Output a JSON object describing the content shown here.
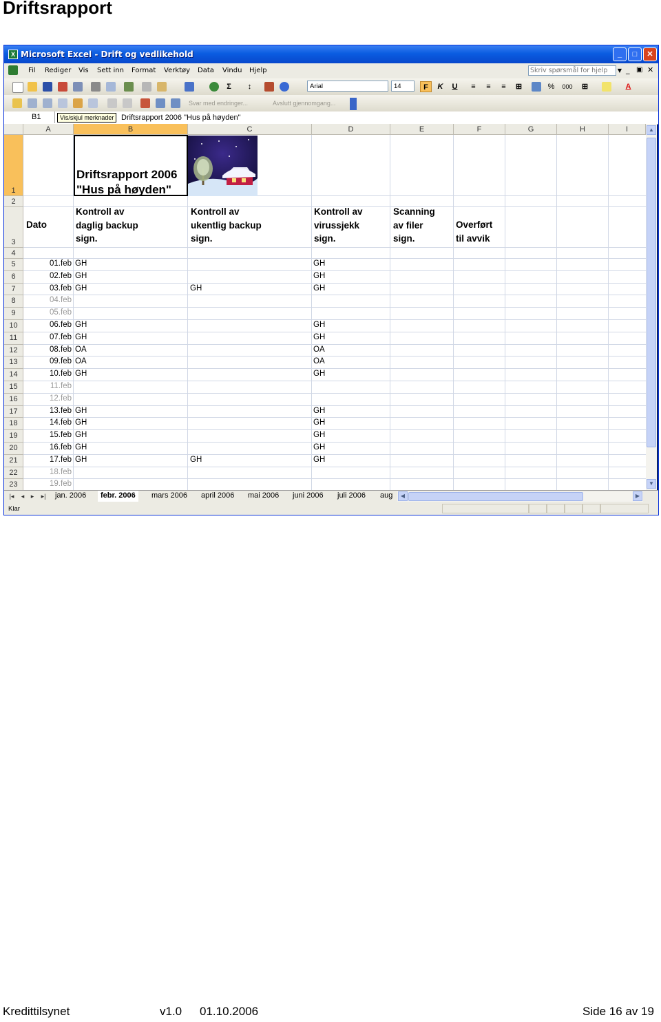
{
  "page": {
    "heading": "Driftsrapport"
  },
  "window": {
    "title": "Microsoft Excel - Drift og vedlikehold",
    "app_icon": "excel-icon"
  },
  "menu": {
    "items": [
      "Fil",
      "Rediger",
      "Vis",
      "Sett inn",
      "Format",
      "Verktøy",
      "Data",
      "Vindu",
      "Hjelp"
    ],
    "help_placeholder": "Skriv spørsmål for hjelp"
  },
  "toolbar": {
    "font": "Arial",
    "size": "14",
    "bold": "F",
    "italic": "K",
    "underline": "U",
    "percent": "%",
    "thousands": "000",
    "review_reply": "Svar med endringer...",
    "review_end": "Avslutt gjennomgang..."
  },
  "formula": {
    "namebox": "B1",
    "tooltip": "Vis/skjul merknader",
    "content": "Driftsrapport 2006 \"Hus på høyden\""
  },
  "columns": [
    "A",
    "B",
    "C",
    "D",
    "E",
    "F",
    "G",
    "H",
    "I"
  ],
  "rows": [
    "1",
    "2",
    "3",
    "4",
    "5",
    "6",
    "7",
    "8",
    "9",
    "10",
    "11",
    "12",
    "13",
    "14",
    "15",
    "16",
    "17",
    "18",
    "19",
    "20",
    "21",
    "22",
    "23"
  ],
  "sheet": {
    "title_line1": "Driftsrapport 2006",
    "title_line2": "\"Hus på høyden\"",
    "hdr_dato": "Dato",
    "hdr_b": [
      "Kontroll av",
      "daglig backup",
      "sign."
    ],
    "hdr_c": [
      "Kontroll av",
      "ukentlig backup",
      "sign."
    ],
    "hdr_d": [
      "Kontroll av",
      "virussjekk",
      "sign."
    ],
    "hdr_e": [
      "Scanning",
      "av filer",
      "sign."
    ],
    "hdr_f": [
      "Overført",
      "til avvik"
    ],
    "data": [
      {
        "date": "01.feb",
        "b": "GH",
        "c": "",
        "d": "GH",
        "weekend": false
      },
      {
        "date": "02.feb",
        "b": "GH",
        "c": "",
        "d": "GH",
        "weekend": false
      },
      {
        "date": "03.feb",
        "b": "GH",
        "c": "GH",
        "d": "GH",
        "weekend": false
      },
      {
        "date": "04.feb",
        "b": "",
        "c": "",
        "d": "",
        "weekend": true
      },
      {
        "date": "05.feb",
        "b": "",
        "c": "",
        "d": "",
        "weekend": true
      },
      {
        "date": "06.feb",
        "b": "GH",
        "c": "",
        "d": "GH",
        "weekend": false
      },
      {
        "date": "07.feb",
        "b": "GH",
        "c": "",
        "d": "GH",
        "weekend": false
      },
      {
        "date": "08.feb",
        "b": "OA",
        "c": "",
        "d": "OA",
        "weekend": false
      },
      {
        "date": "09.feb",
        "b": "OA",
        "c": "",
        "d": "OA",
        "weekend": false
      },
      {
        "date": "10.feb",
        "b": "GH",
        "c": "",
        "d": "GH",
        "weekend": false
      },
      {
        "date": "11.feb",
        "b": "",
        "c": "",
        "d": "",
        "weekend": true
      },
      {
        "date": "12.feb",
        "b": "",
        "c": "",
        "d": "",
        "weekend": true
      },
      {
        "date": "13.feb",
        "b": "GH",
        "c": "",
        "d": "GH",
        "weekend": false
      },
      {
        "date": "14.feb",
        "b": "GH",
        "c": "",
        "d": "GH",
        "weekend": false
      },
      {
        "date": "15.feb",
        "b": "GH",
        "c": "",
        "d": "GH",
        "weekend": false
      },
      {
        "date": "16.feb",
        "b": "GH",
        "c": "",
        "d": "GH",
        "weekend": false
      },
      {
        "date": "17.feb",
        "b": "GH",
        "c": "GH",
        "d": "GH",
        "weekend": false
      },
      {
        "date": "18.feb",
        "b": "",
        "c": "",
        "d": "",
        "weekend": true
      },
      {
        "date": "19.feb",
        "b": "",
        "c": "",
        "d": "",
        "weekend": true
      }
    ]
  },
  "tabs": [
    "jan. 2006",
    "febr. 2006",
    "mars 2006",
    "april 2006",
    "mai 2006",
    "juni 2006",
    "juli 2006",
    "aug"
  ],
  "active_tab": "febr. 2006",
  "status": "Klar",
  "footer": {
    "org": "Kredittilsynet",
    "version": "v1.0",
    "date": "01.10.2006",
    "page": "Side 16 av 19"
  },
  "colors": {
    "title_blue": "#0a5ce1",
    "selection": "#f9c05b",
    "chrome": "#ecebe3"
  }
}
